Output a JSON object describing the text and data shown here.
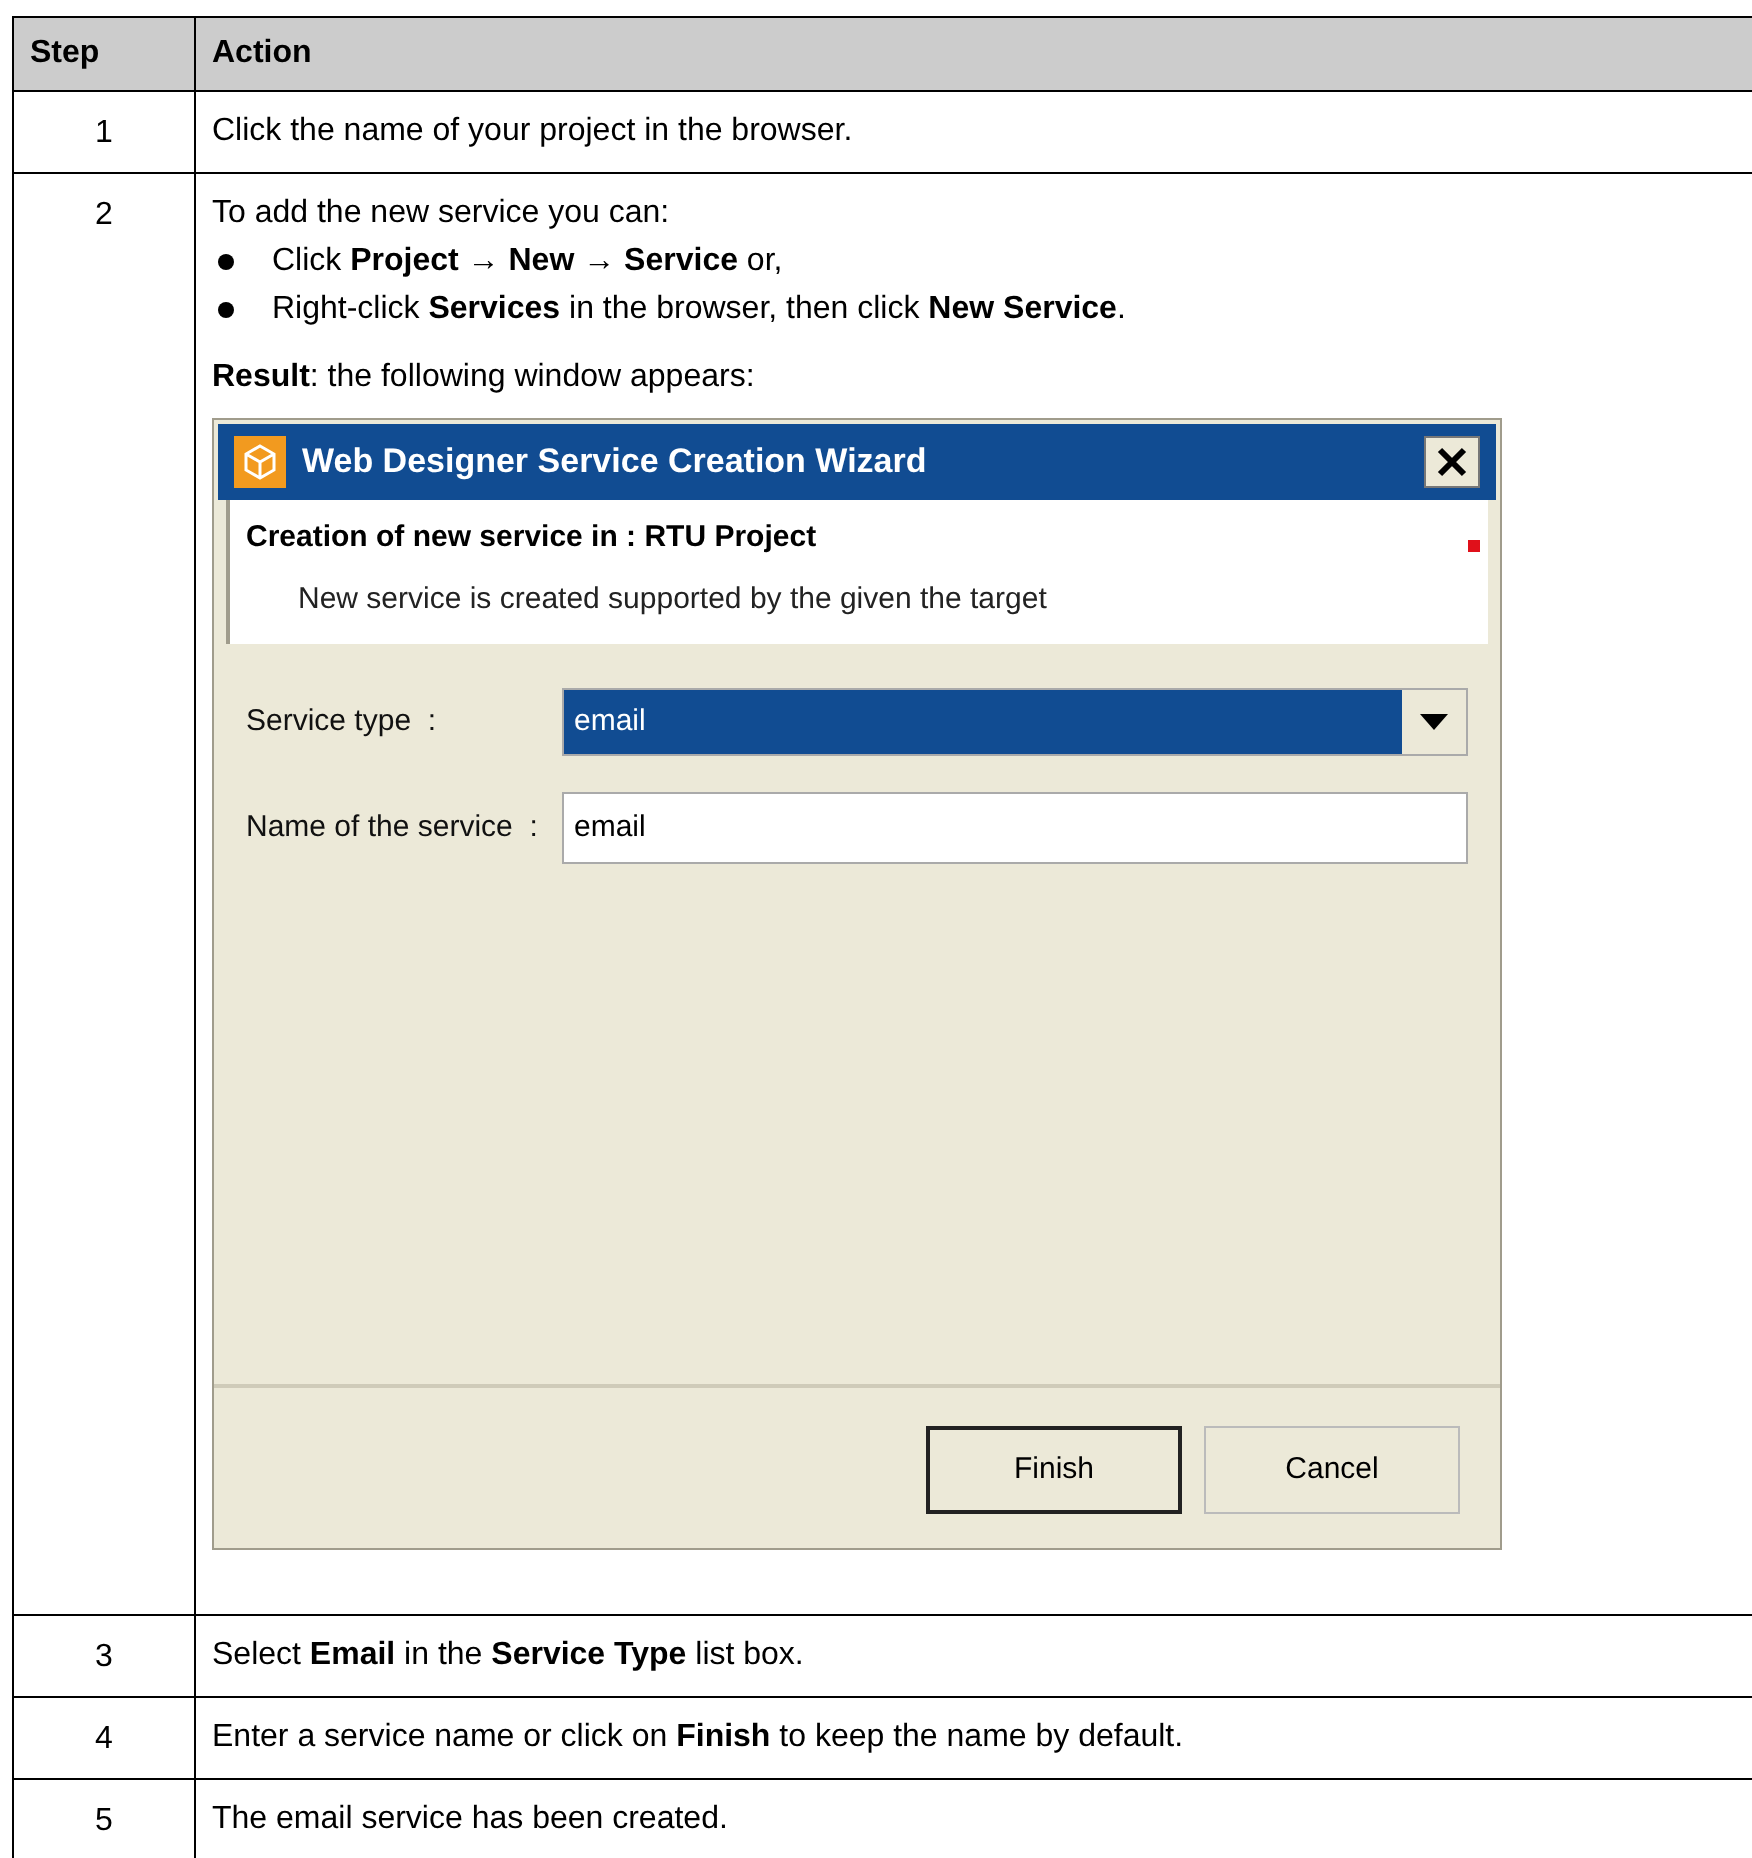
{
  "table": {
    "columns": [
      "Step",
      "Action"
    ],
    "rows": [
      {
        "kind": "text",
        "step": "1",
        "text": "Click the name of your project in the browser."
      },
      {
        "kind": "dialog",
        "step": "2",
        "intro": "To add the new service you can:",
        "bullets": [
          "Click **Project** → **New** → **Service** or,",
          "Right-click **Services** in the browser, then click **New Service**."
        ],
        "result": "**Result**: the following window appears:",
        "window": {
          "title": "Web Designer Service Creation Wizard",
          "header_title": "Creation of new service in : RTU Project",
          "header_text": "New service is created supported by the given the target",
          "fields": [
            {
              "kind": "dropdown",
              "label": "Service type  :",
              "value": "email",
              "selected": true
            },
            {
              "kind": "text",
              "label": "Name of the service  :",
              "value": "email",
              "selected": false
            }
          ],
          "buttons": [
            {
              "label": "Finish",
              "focused": true
            },
            {
              "label": "Cancel",
              "focused": false
            }
          ]
        }
      },
      {
        "kind": "text",
        "step": "3",
        "text": "Select **Email** in the **Service Type** list box."
      },
      {
        "kind": "text",
        "step": "4",
        "text": "Enter a service name or click on **Finish** to keep the name by default."
      },
      {
        "kind": "text",
        "step": "5",
        "text": "The email service has been created."
      }
    ]
  }
}
